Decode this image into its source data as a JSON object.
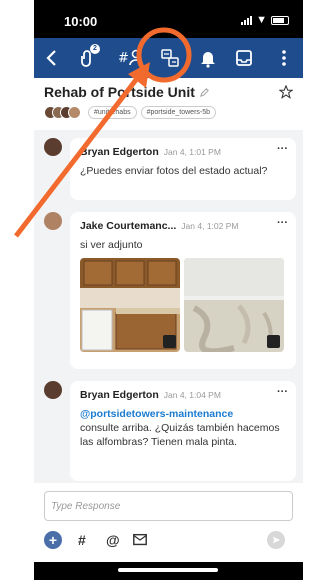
{
  "status": {
    "time": "10:00"
  },
  "toolbar": {
    "attachments_badge": "2"
  },
  "header": {
    "title": "Rehab of Portside Unit",
    "tags": [
      "#unitrehabs",
      "#portside_towers-5b"
    ]
  },
  "messages": [
    {
      "sender": "Bryan Edgerton",
      "time": "Jan 4, 1:01 PM",
      "text": "¿Puedes enviar fotos del estado actual?"
    },
    {
      "sender": "Jake Courtemanc...",
      "time": "Jan 4, 1:02 PM",
      "text": "si ver adjunto"
    },
    {
      "sender": "Bryan Edgerton",
      "time": "Jan 4, 1:04 PM",
      "mention": "@portsidetowers-maintenance",
      "text": "consulte arriba. ¿Quizás también hacemos las alfombras? Tienen mala pinta."
    }
  ],
  "composer": {
    "placeholder": "Type Response"
  },
  "colors": {
    "toolbar": "#1f4c8c",
    "mention": "#1a7bd0",
    "annotation": "#f26a2e"
  },
  "icons": [
    "back-icon",
    "attachment-icon",
    "members-icon",
    "translate-icon",
    "bell-icon",
    "inbox-icon",
    "more-vertical-icon",
    "star-icon",
    "pencil-icon",
    "plus-icon",
    "hashtag-icon",
    "at-icon",
    "mail-icon",
    "send-icon"
  ]
}
